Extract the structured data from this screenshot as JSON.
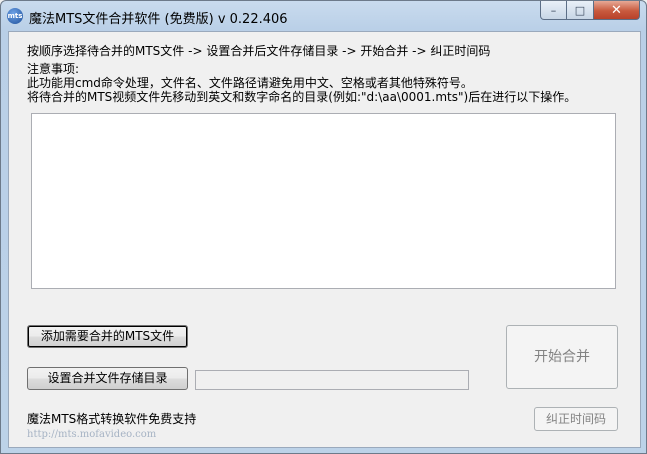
{
  "window": {
    "title": "魔法MTS文件合并软件 (免费版) v 0.22.406",
    "icon": "mts-app-icon",
    "icon_text": "mts",
    "minimize_glyph": "–",
    "maximize_glyph": "□",
    "close_glyph": "✕"
  },
  "instructions": {
    "steps": "按顺序选择待合并的MTS文件 -> 设置合并后文件存储目录  -> 开始合并 -> 纠正时间码",
    "notes_heading": "注意事项:",
    "note_1": "此功能用cmd命令处理，文件名、文件路径请避免用中文、空格或者其他特殊符号。",
    "note_2": "将待合并的MTS视频文件先移动到英文和数字命名的目录(例如:\"d:\\aa\\0001.mts\")后在进行以下操作。"
  },
  "file_list": {
    "value": ""
  },
  "buttons": {
    "add_files": "添加需要合并的MTS文件",
    "set_dir": "设置合并文件存储目录",
    "start_merge": "开始合并",
    "fix_timecode": "纠正时间码"
  },
  "output_dir": {
    "value": ""
  },
  "footer": {
    "support": "魔法MTS格式转换软件免费支持",
    "url": "http://mts.mofavideo.com"
  }
}
